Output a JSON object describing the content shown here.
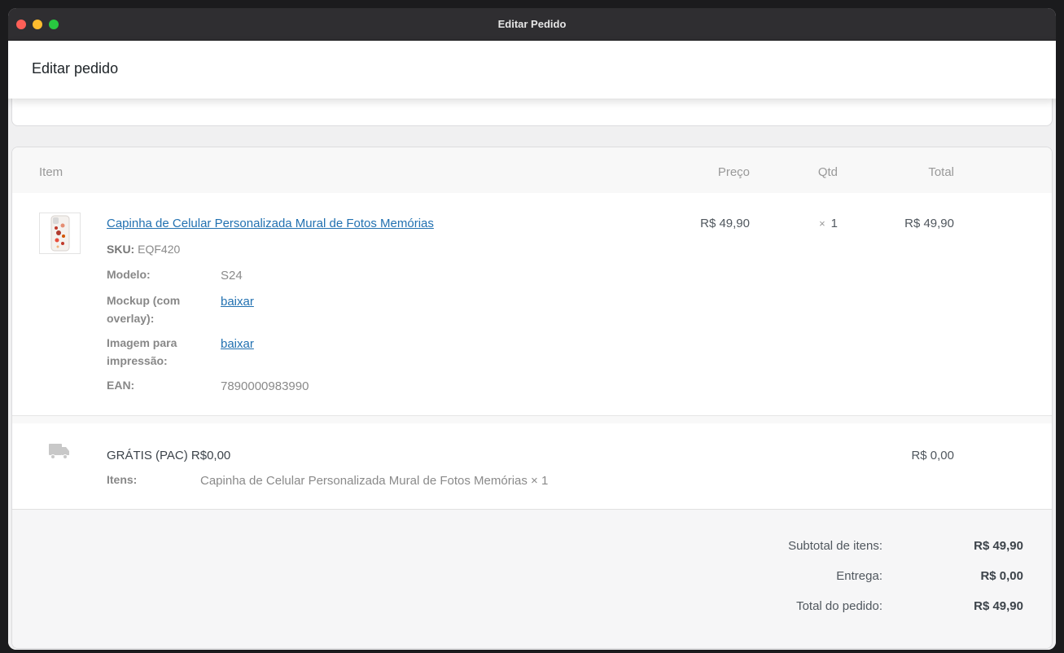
{
  "window": {
    "title": "Editar Pedido"
  },
  "header": {
    "title": "Editar pedido"
  },
  "table": {
    "headers": {
      "item": "Item",
      "price": "Preço",
      "qty": "Qtd",
      "total": "Total"
    }
  },
  "item": {
    "name": "Capinha de Celular Personalizada Mural de Fotos Memórias",
    "sku_label": "SKU:",
    "sku_value": "EQF420",
    "meta": [
      {
        "label": "Modelo:",
        "value": "S24"
      },
      {
        "label": "Mockup (com overlay):",
        "value": "baixar"
      },
      {
        "label": "Imagem para impressão:",
        "value": "baixar"
      },
      {
        "label": "EAN:",
        "value": "7890000983990"
      }
    ],
    "price": "R$ 49,90",
    "qty_symbol": "×",
    "qty": "1",
    "total": "R$ 49,90",
    "thumbnail_icon": "phone-case-icon"
  },
  "shipping": {
    "icon": "truck-icon",
    "name": "GRÁTIS (PAC) R$0,00",
    "items_label": "Itens:",
    "items_value": "Capinha de Celular Personalizada Mural de Fotos Memórias × 1",
    "total": "R$ 0,00"
  },
  "totals": {
    "subtotal_label": "Subtotal de itens:",
    "subtotal_value": "R$ 49,90",
    "shipping_label": "Entrega:",
    "shipping_value": "R$ 0,00",
    "order_total_label": "Total do pedido:",
    "order_total_value": "R$ 49,90"
  },
  "colors": {
    "link": "#2271b1",
    "titlebar": "#2f2e31",
    "close": "#fe5f57",
    "minimize": "#febc2e",
    "maximize": "#28c840"
  }
}
